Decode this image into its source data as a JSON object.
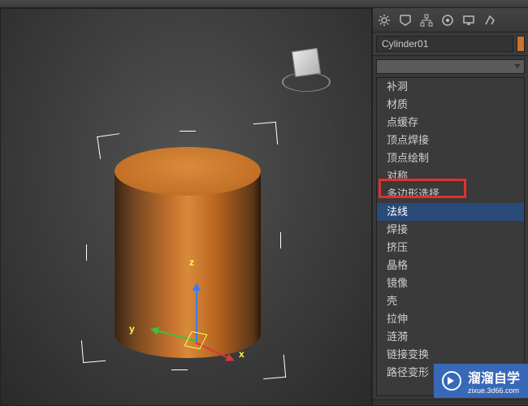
{
  "object": {
    "name": "Cylinder01"
  },
  "modifiers": {
    "items": [
      "补洞",
      "材质",
      "点缓存",
      "顶点焊接",
      "顶点绘制",
      "对称",
      "多边形选择",
      "法线",
      "焊接",
      "挤压",
      "晶格",
      "镜像",
      "壳",
      "拉伸",
      "涟漪",
      "链接变换",
      "路径变形"
    ],
    "selected_index": 7
  },
  "axes": {
    "x": "x",
    "y": "y",
    "z": "z"
  },
  "watermark": {
    "title": "溜溜自学",
    "url": "zixue.3d66.com"
  },
  "colors": {
    "object_color": "#c87430"
  }
}
